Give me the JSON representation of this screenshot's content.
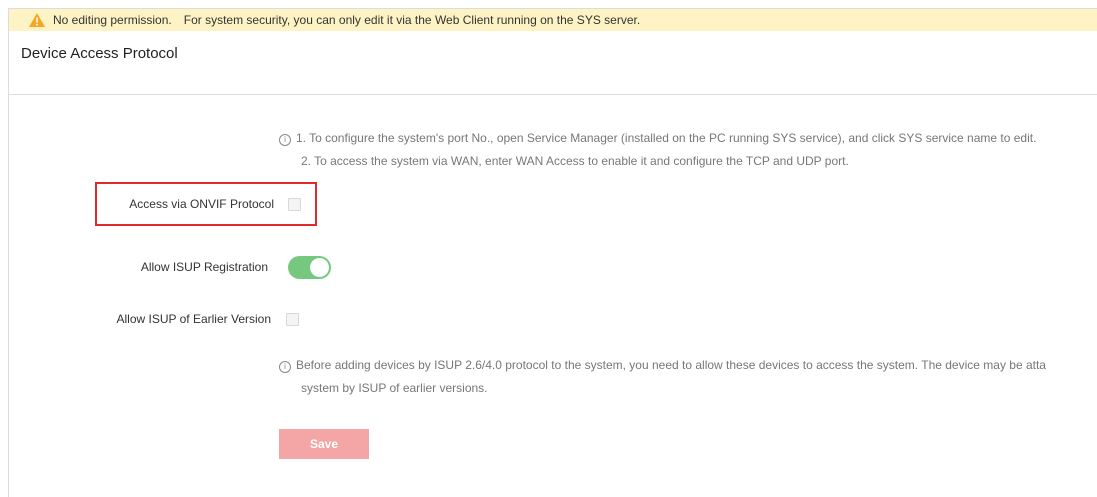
{
  "warning": {
    "icon": "warning-triangle-icon",
    "color": "#f5a623",
    "background": "#fdf3c4",
    "title": "No editing permission.",
    "message": "For system security, you can only edit it via the Web Client running on the SYS server."
  },
  "header": {
    "title": "Device Access Protocol"
  },
  "info_top": {
    "icon": "info-icon",
    "line1": "1. To configure the system's port No., open Service Manager (installed on the PC running SYS service), and click SYS service name to edit.",
    "line2": "2. To access the system via WAN, enter WAN Access to enable it and configure the TCP and UDP port."
  },
  "form": {
    "onvif": {
      "label": "Access via ONVIF Protocol",
      "checked": false,
      "highlight_color": "#e02b2b"
    },
    "isup": {
      "label": "Allow ISUP Registration",
      "enabled": true,
      "toggle_color": "#76c87e"
    },
    "isup_old": {
      "label": "Allow ISUP of Earlier Version",
      "checked": false
    }
  },
  "info_bottom": {
    "icon": "info-icon",
    "line1": "Before adding devices by ISUP 2.6/4.0 protocol to the system, you need to allow these devices to access the system. The device may be atta",
    "line2": "system by ISUP of earlier versions."
  },
  "actions": {
    "save_label": "Save",
    "save_color": "#f4a5a5"
  }
}
